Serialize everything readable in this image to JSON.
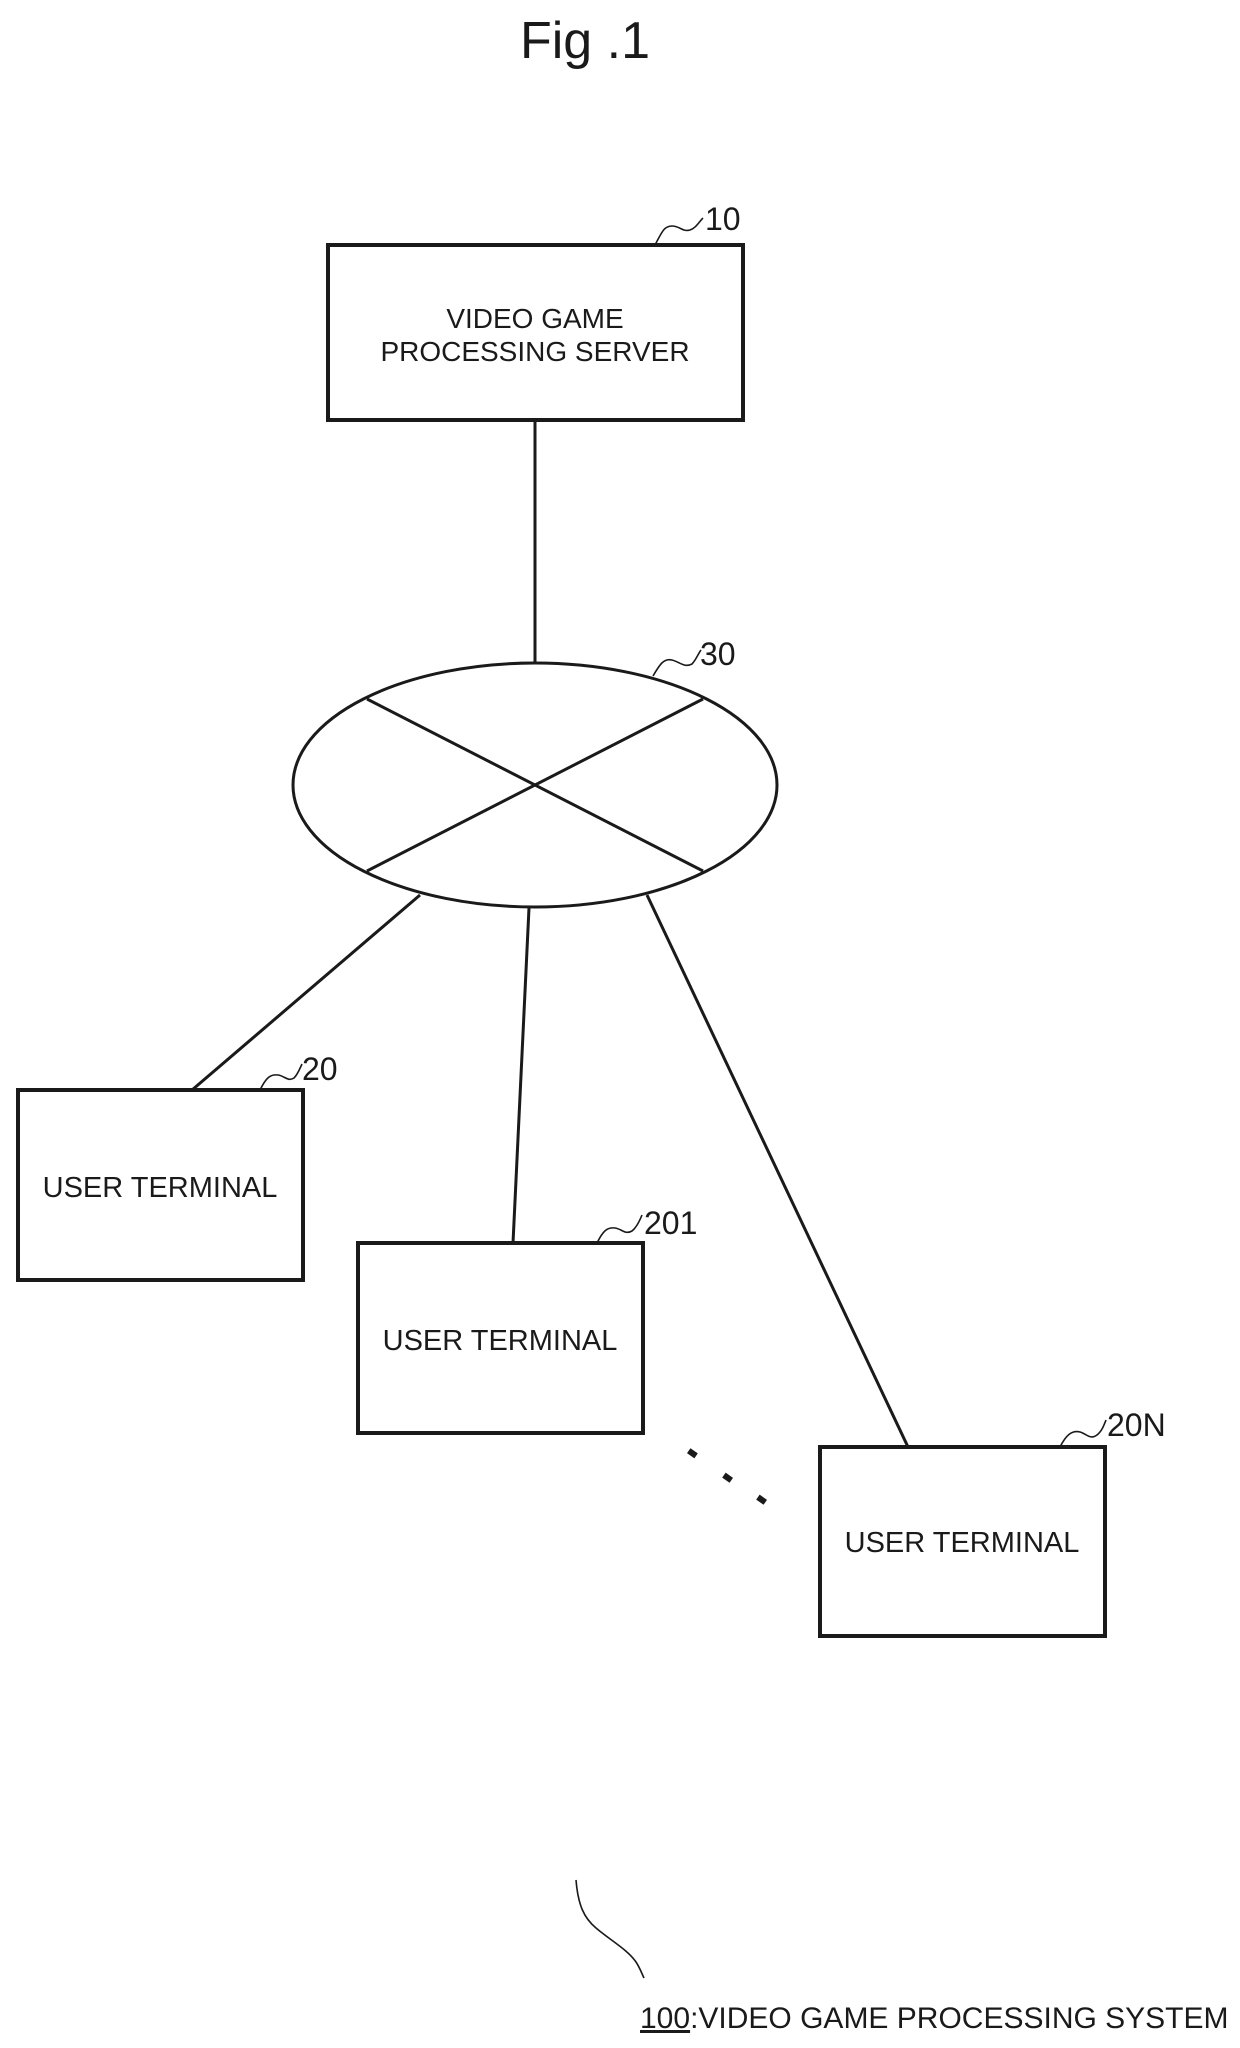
{
  "figure": {
    "title": "Fig .1",
    "caption": {
      "ref": "100",
      "separator": ":",
      "label": "VIDEO GAME PROCESSING SYSTEM"
    }
  },
  "nodes": {
    "server": {
      "ref": "10",
      "line1": "VIDEO GAME",
      "line2": "PROCESSING SERVER"
    },
    "network": {
      "ref": "30"
    },
    "terminals": [
      {
        "ref": "20",
        "label": "USER TERMINAL"
      },
      {
        "ref": "201",
        "label": "USER TERMINAL"
      },
      {
        "ref": "20N",
        "label": "USER TERMINAL"
      }
    ],
    "ellipsis": "..."
  },
  "colors": {
    "ink": "#1a1a1a",
    "background": "#ffffff"
  }
}
